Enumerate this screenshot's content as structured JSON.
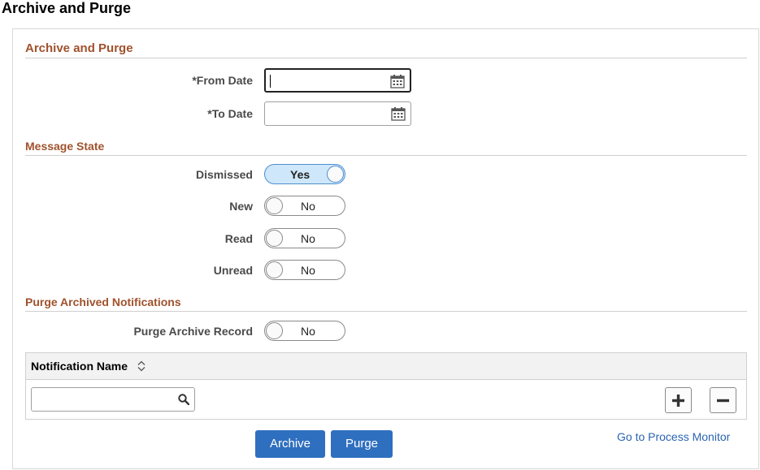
{
  "page": {
    "title": "Archive and Purge"
  },
  "archive_section": {
    "heading": "Archive and Purge",
    "from_date_label": "*From Date",
    "from_date_value": "",
    "to_date_label": "*To Date",
    "to_date_value": ""
  },
  "message_state": {
    "heading": "Message State",
    "items": [
      {
        "label": "Dismissed",
        "state": "Yes",
        "on": true
      },
      {
        "label": "New",
        "state": "No",
        "on": false
      },
      {
        "label": "Read",
        "state": "No",
        "on": false
      },
      {
        "label": "Unread",
        "state": "No",
        "on": false
      }
    ]
  },
  "purge_section": {
    "heading": "Purge Archived Notifications",
    "purge_record_label": "Purge Archive Record",
    "purge_record_state": "No"
  },
  "grid": {
    "column_header": "Notification Name",
    "rows": [
      {
        "notification_name": ""
      }
    ]
  },
  "actions": {
    "archive_label": "Archive",
    "purge_label": "Purge",
    "process_monitor_link": "Go to Process Monitor"
  },
  "icons": {
    "calendar": "calendar-icon",
    "search": "search-icon",
    "sort": "sort-icon",
    "add": "plus-icon",
    "delete": "minus-icon"
  },
  "colors": {
    "section_heading": "#a0522d",
    "primary_button": "#2f6fbf",
    "toggle_on_bg": "#cfe7fa",
    "link": "#2a64b0"
  }
}
